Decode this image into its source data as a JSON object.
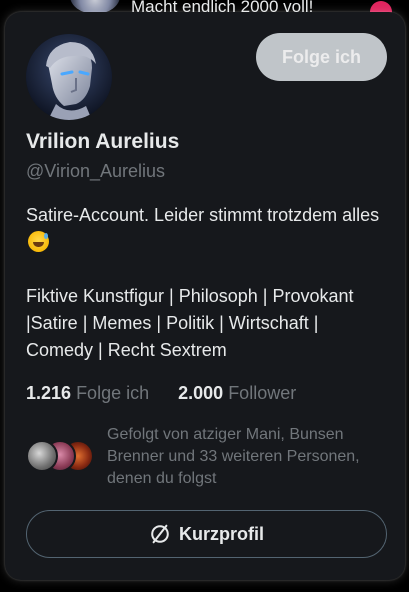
{
  "background": {
    "tweet_text": "Macht endlich 2000 voll!"
  },
  "profile": {
    "display_name": "Vrilion Aurelius",
    "handle": "@Virion_Aurelius",
    "follow_button_label": "Folge ich",
    "bio_line1": "Satire-Account. Leider stimmt trotzdem alles",
    "bio_emoji": "sweat-smile-emoji",
    "bio_line2": "Fiktive Kunstfigur | Philosoph | Provokant |Satire | Memes | Politik | Wirtschaft | Comedy | Recht Sextrem"
  },
  "stats": {
    "following_count": "1.216",
    "following_label": "Folge ich",
    "followers_count": "2.000",
    "followers_label": "Follower"
  },
  "followed_by": {
    "text": "Gefolgt von atziger Mani, Bunsen Brenner und 33 weiteren Personen, denen du folgst"
  },
  "profile_summary_button": {
    "label": "Kurzprofil",
    "icon": "slashed-circle-icon"
  },
  "colors": {
    "card_bg": "#16181c",
    "text_primary": "#e7e9ea",
    "text_secondary": "#71767b",
    "follow_button_bg": "#cfd4d8",
    "outline_border": "#536471"
  }
}
